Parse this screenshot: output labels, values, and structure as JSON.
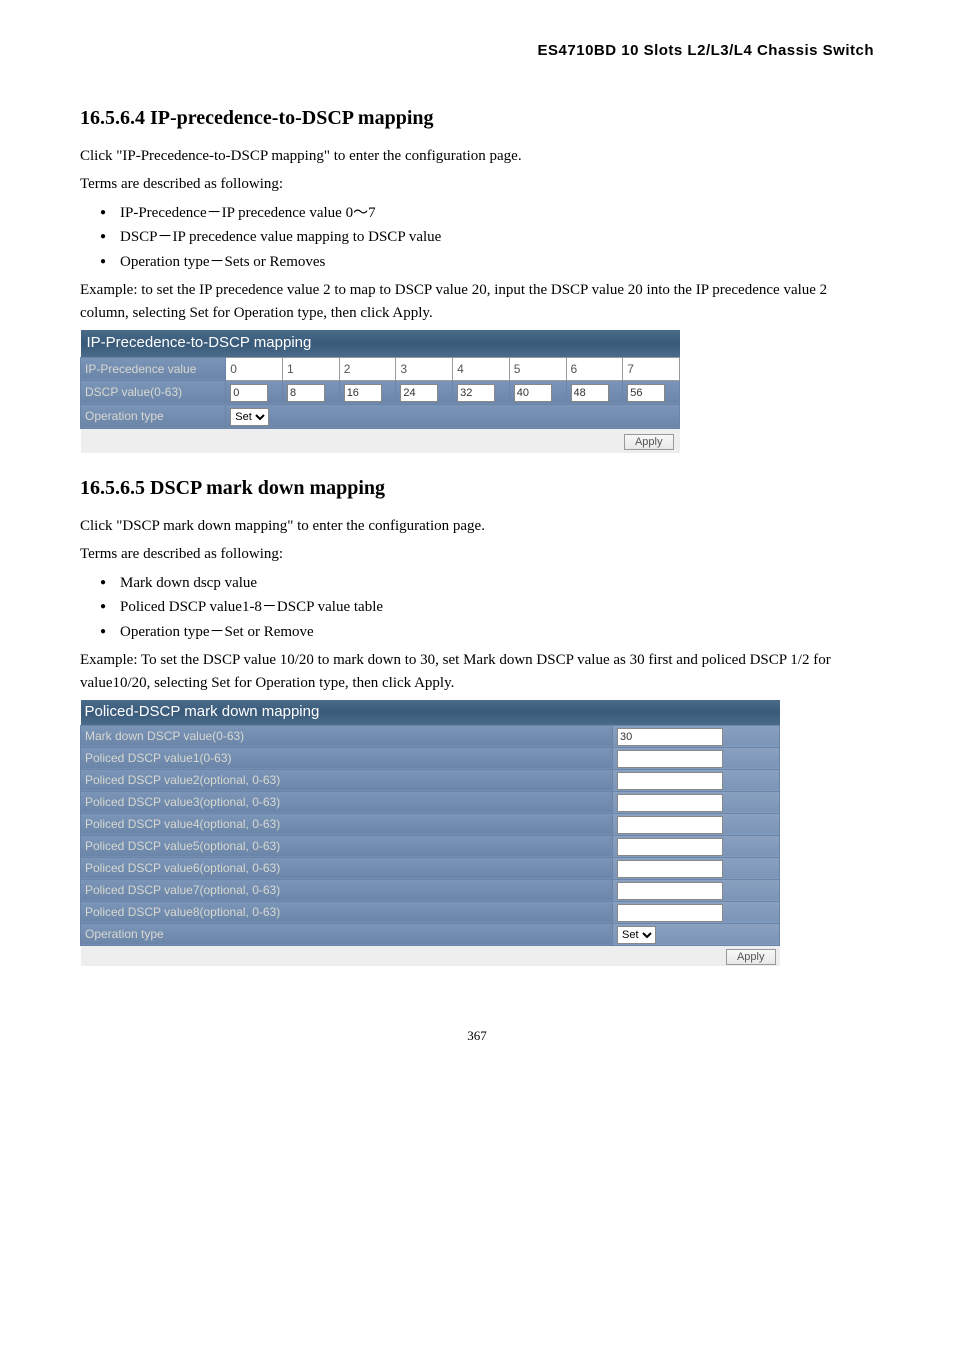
{
  "header": "ES4710BD 10 Slots L2/L3/L4 Chassis Switch",
  "section1": {
    "heading": "16.5.6.4 IP-precedence-to-DSCP mapping",
    "intro": "Click \"IP-Precedence-to-DSCP mapping\" to enter the configuration page.",
    "terms_label": "Terms are described as following:",
    "bullets": [
      "IP-Precedence－IP precedence value 0～7",
      "DSCP－IP precedence value mapping to DSCP value",
      "Operation type－Sets or Removes"
    ],
    "example": "Example: to set the IP precedence value 2 to map to DSCP value 20, input the DSCP value 20 into the IP precedence value 2 column, selecting Set for Operation type, then click Apply.",
    "table": {
      "title": "IP-Precedence-to-DSCP mapping",
      "row1_label": "IP-Precedence value",
      "row1_values": [
        "0",
        "1",
        "2",
        "3",
        "4",
        "5",
        "6",
        "7"
      ],
      "row2_label": "DSCP value(0-63)",
      "row2_values": [
        "0",
        "8",
        "16",
        "24",
        "32",
        "40",
        "48",
        "56"
      ],
      "row3_label": "Operation type",
      "row3_value": "Set",
      "apply": "Apply"
    }
  },
  "section2": {
    "heading": "16.5.6.5 DSCP mark down mapping",
    "intro": "Click \"DSCP mark down mapping\" to enter the configuration page.",
    "terms_label": "Terms are described as following:",
    "bullets": [
      "Mark down dscp value",
      "Policed DSCP value1-8－DSCP value table",
      "Operation type－Set or Remove"
    ],
    "example": "Example: To set the DSCP value 10/20 to mark down to 30, set Mark down DSCP value as 30 first and policed DSCP 1/2 for value10/20, selecting Set for Operation type, then click Apply.",
    "table": {
      "title": "Policed-DSCP mark down mapping",
      "rows": [
        {
          "label": "Mark down DSCP value(0-63)",
          "value": "30"
        },
        {
          "label": "Policed DSCP value1(0-63)",
          "value": ""
        },
        {
          "label": "Policed DSCP value2(optional, 0-63)",
          "value": ""
        },
        {
          "label": "Policed DSCP value3(optional, 0-63)",
          "value": ""
        },
        {
          "label": "Policed DSCP value4(optional, 0-63)",
          "value": ""
        },
        {
          "label": "Policed DSCP value5(optional, 0-63)",
          "value": ""
        },
        {
          "label": "Policed DSCP value6(optional, 0-63)",
          "value": ""
        },
        {
          "label": "Policed DSCP value7(optional, 0-63)",
          "value": ""
        },
        {
          "label": "Policed DSCP value8(optional, 0-63)",
          "value": ""
        }
      ],
      "op_label": "Operation type",
      "op_value": "Set",
      "apply": "Apply"
    }
  },
  "page_number": "367"
}
